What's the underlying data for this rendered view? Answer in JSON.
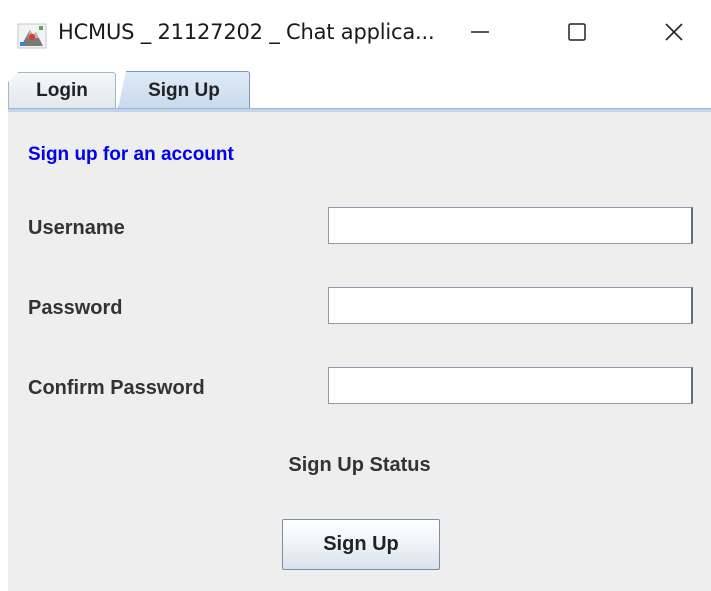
{
  "window": {
    "title": "HCMUS _ 21127202 _ Chat applica...",
    "icon": "java-duke-icon"
  },
  "tabs": [
    {
      "label": "Login",
      "selected": false
    },
    {
      "label": "Sign Up",
      "selected": true
    }
  ],
  "form": {
    "heading": "Sign up for an account",
    "fields": [
      {
        "label": "Username",
        "value": ""
      },
      {
        "label": "Password",
        "value": ""
      },
      {
        "label": "Confirm Password",
        "value": ""
      }
    ],
    "status": "Sign Up Status",
    "submit_label": "Sign Up"
  },
  "colors": {
    "heading": "#0000ee",
    "panel_bg": "#eeeeee",
    "selected_tab": "#c9daee"
  }
}
